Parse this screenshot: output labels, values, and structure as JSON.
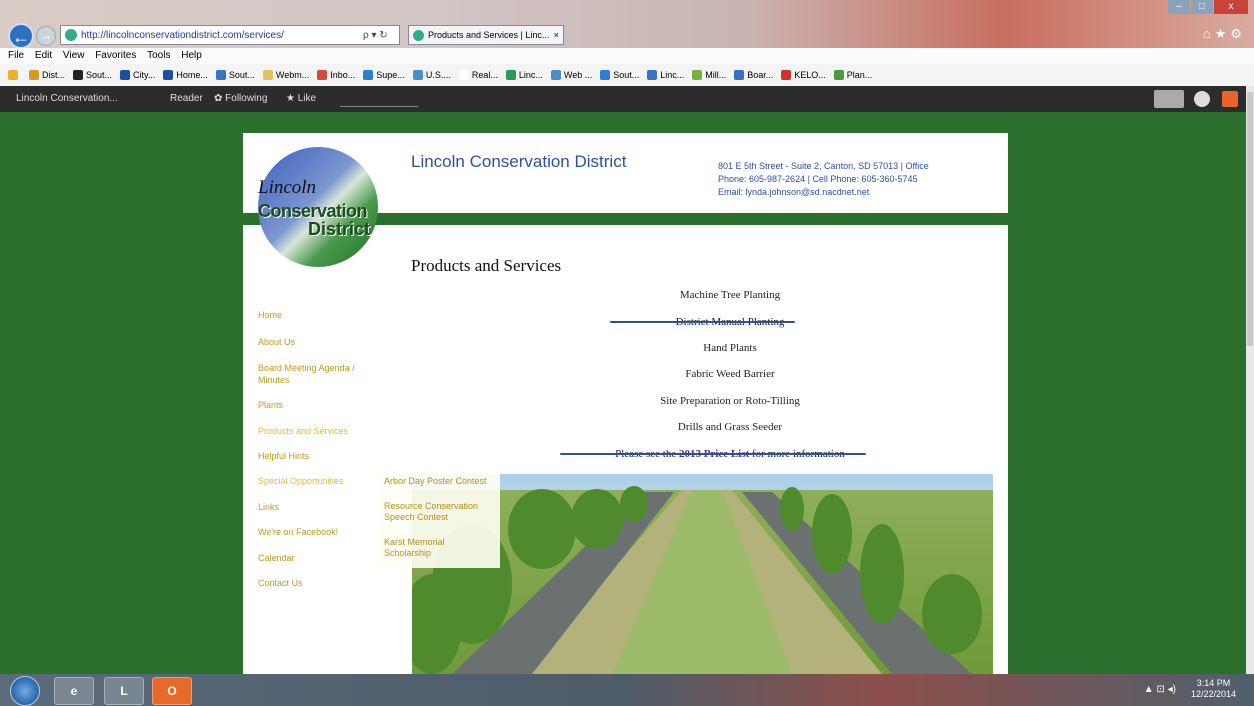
{
  "browser": {
    "url": "http://lincolnconservationdistrict.com/services/",
    "address_controls": "ρ ▾ ↻",
    "tab_title": "Products and Services | Linc...",
    "tab_close": "×",
    "menu": [
      "File",
      "Edit",
      "View",
      "Favorites",
      "Tools",
      "Help"
    ],
    "favorites": [
      {
        "label": "Dist...",
        "color": "#d49c1e"
      },
      {
        "label": "Sout...",
        "color": "#222222"
      },
      {
        "label": "City...",
        "color": "#1d4fa0"
      },
      {
        "label": "Home...",
        "color": "#1d4fa0"
      },
      {
        "label": "Sout...",
        "color": "#3773c0"
      },
      {
        "label": "Webm...",
        "color": "#e0c35a"
      },
      {
        "label": "Inbo...",
        "color": "#d24a3a"
      },
      {
        "label": "Supe...",
        "color": "#2a7fd0"
      },
      {
        "label": "U.S....",
        "color": "#4a8ec8"
      },
      {
        "label": "Real...",
        "color": "#ffffff"
      },
      {
        "label": "Linc...",
        "color": "#2a9a55"
      },
      {
        "label": "Web ...",
        "color": "#4a8ec8"
      },
      {
        "label": "Sout...",
        "color": "#2a7fd0"
      },
      {
        "label": "Linc...",
        "color": "#3773c0"
      },
      {
        "label": "Mill...",
        "color": "#7ab13e"
      },
      {
        "label": "Boar...",
        "color": "#3a6fc8"
      },
      {
        "label": "KELO...",
        "color": "#d2322a"
      },
      {
        "label": "Plan...",
        "color": "#4a9a3a"
      }
    ]
  },
  "sitebar": {
    "site_name": "Lincoln Conservation...",
    "reader": "Reader",
    "following": "✿ Following",
    "like": "★ Like"
  },
  "site": {
    "logo_line1": "Lincoln",
    "logo_line2": "Conservation",
    "logo_line3": "District",
    "title": "Lincoln Conservation District",
    "contact_line1": "801 E 5th Street - Suite 2, Canton, SD 57013 | Office",
    "contact_line2": "Phone: 605-987-2624 | Cell Phone: 605-360-5745",
    "contact_line3": "Email: lynda.johnson@sd.nacdnet.net",
    "page_heading": "Products and Services",
    "nav": [
      {
        "label": "Home"
      },
      {
        "label": "About Us"
      },
      {
        "label": "Board Meeting Agenda / Minutes"
      },
      {
        "label": "Plants"
      },
      {
        "label": "Products and Services",
        "active": true
      },
      {
        "label": "Helpful Hints"
      },
      {
        "label": "Special Opportunities"
      },
      {
        "label": "Links"
      },
      {
        "label": "We're on Facebook!"
      },
      {
        "label": "Calendar"
      },
      {
        "label": "Contact Us"
      }
    ],
    "submenu": [
      "Arbor Day Poster Contest",
      "Resource Conservation Speech Contest",
      "Karst Memorial Scholarship"
    ],
    "products": [
      "Machine Tree Planting",
      "District Manual Planting",
      "Hand Plants",
      "Fabric Weed Barrier",
      "Site Preparation or Roto-Tilling",
      "Drills and Grass Seeder"
    ],
    "price_note_before": "Please see the ",
    "price_note_link": "2013 Price List",
    "price_note_after": " for more information"
  },
  "taskbar": {
    "time": "3:14 PM",
    "date": "12/22/2014",
    "app_lync": "L",
    "app_outlook": "O"
  }
}
